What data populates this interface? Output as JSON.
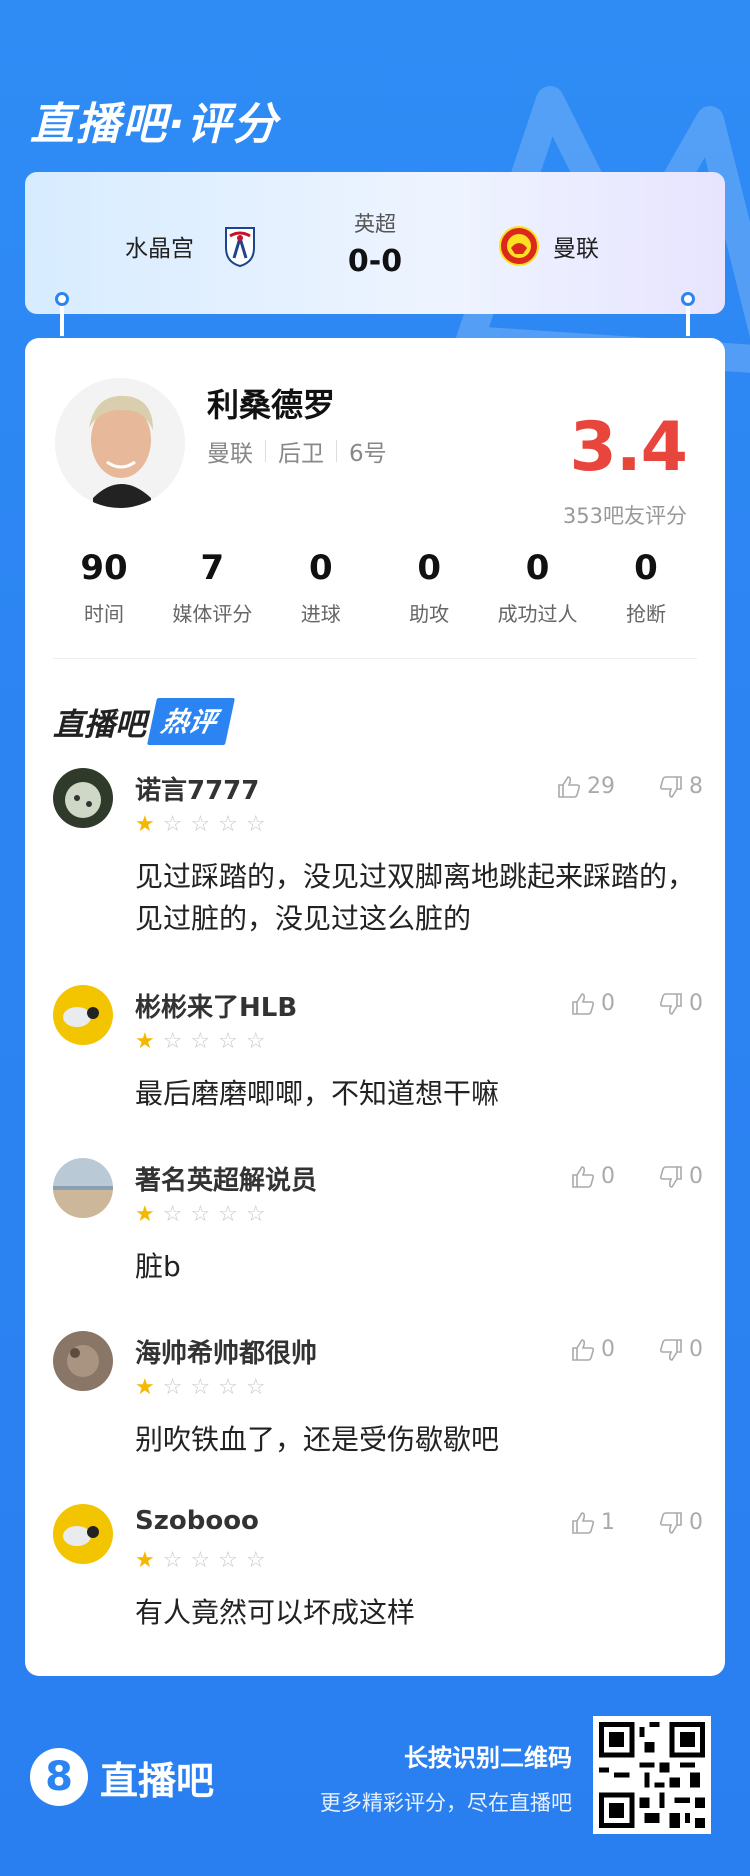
{
  "brand": {
    "title": "直播吧·评分"
  },
  "match": {
    "home": "水晶宫",
    "league": "英超",
    "score": "0-0",
    "away": "曼联"
  },
  "player": {
    "name": "利桑德罗",
    "team": "曼联",
    "position": "后卫",
    "number": "6号",
    "rating": "3.4",
    "rating_count": "353吧友评分"
  },
  "stats": [
    {
      "value": "90",
      "label": "时间"
    },
    {
      "value": "7",
      "label": "媒体评分"
    },
    {
      "value": "0",
      "label": "进球"
    },
    {
      "value": "0",
      "label": "助攻"
    },
    {
      "value": "0",
      "label": "成功过人"
    },
    {
      "value": "0",
      "label": "抢断"
    }
  ],
  "hot_comments": {
    "title_a": "直播吧",
    "title_b": "热评",
    "items": [
      {
        "user": "诺言7777",
        "stars": 1,
        "text": "见过踩踏的，没见过双脚离地跳起来踩踏的，见过脏的，没见过这么脏的",
        "likes": "29",
        "dislikes": "8"
      },
      {
        "user": "彬彬来了HLB",
        "stars": 1,
        "text": "最后磨磨唧唧，不知道想干嘛",
        "likes": "0",
        "dislikes": "0"
      },
      {
        "user": "著名英超解说员",
        "stars": 1,
        "text": "脏b",
        "likes": "0",
        "dislikes": "0"
      },
      {
        "user": "海帅希帅都很帅",
        "stars": 1,
        "text": "别吹铁血了，还是受伤歇歇吧",
        "likes": "0",
        "dislikes": "0"
      },
      {
        "user": "Szobooo",
        "stars": 1,
        "text": "有人竟然可以坏成这样",
        "likes": "1",
        "dislikes": "0"
      }
    ]
  },
  "footer": {
    "logo_num": "8",
    "logo_text": "直播吧",
    "line1": "长按识别二维码",
    "line2": "更多精彩评分，尽在直播吧"
  },
  "colors": {
    "accent": "#2c84f2",
    "rating": "#e8453c",
    "star": "#f5b800"
  },
  "icons": [
    "thumb-up-icon",
    "thumb-down-icon",
    "star-icon",
    "qr-code-icon",
    "team-crest-icon"
  ]
}
